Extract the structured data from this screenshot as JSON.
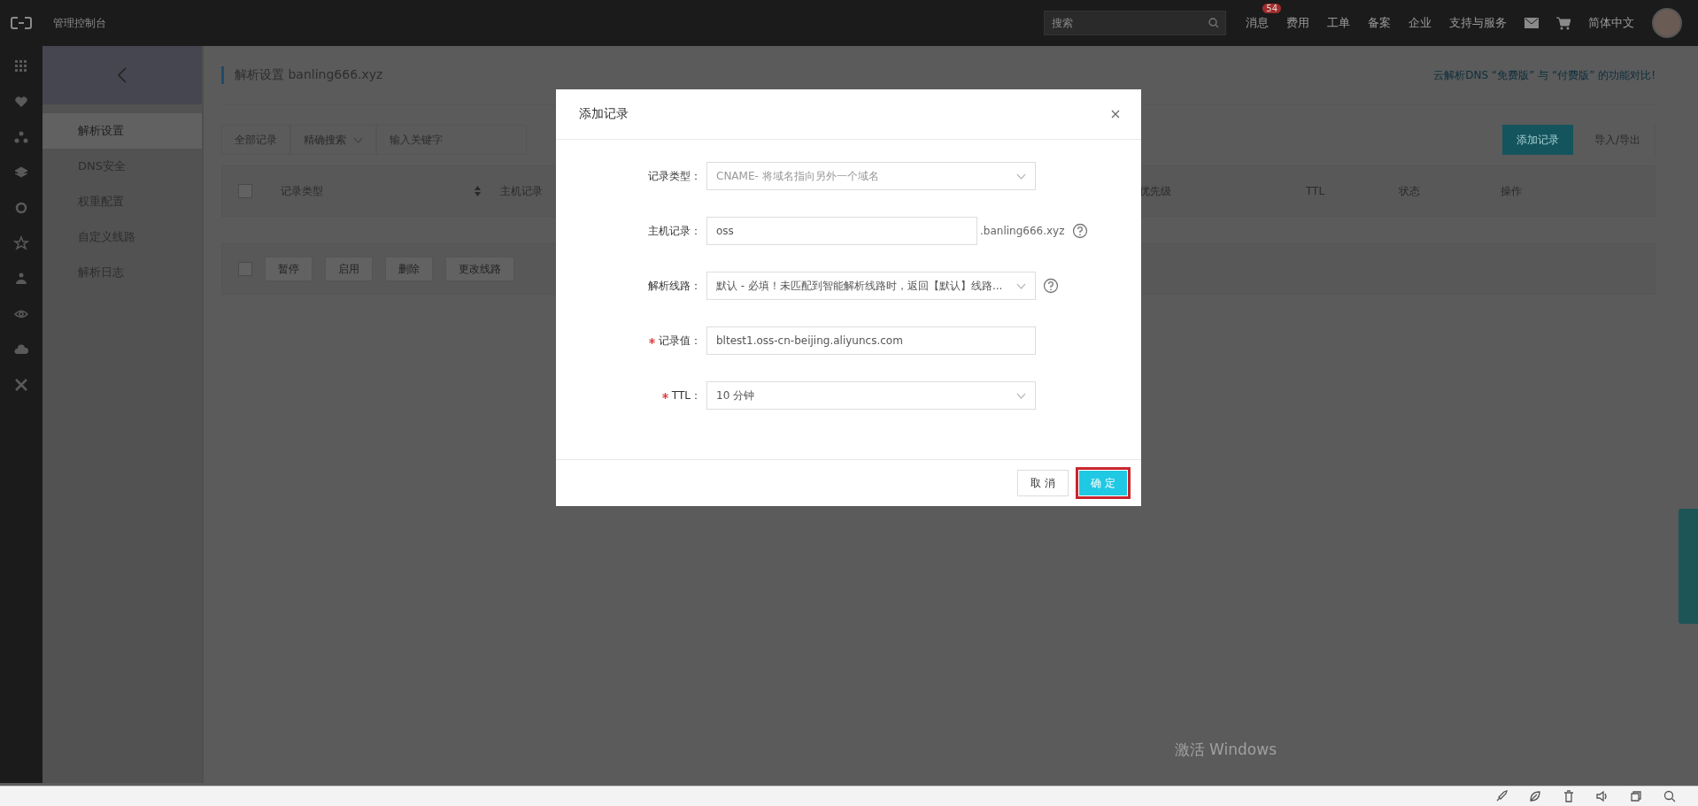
{
  "topbar": {
    "title": "管理控制台",
    "search": {
      "placeholder": "搜索"
    },
    "nav": [
      {
        "label": "消息",
        "badge": "54"
      },
      {
        "label": "费用"
      },
      {
        "label": "工单"
      },
      {
        "label": "备案"
      },
      {
        "label": "企业"
      },
      {
        "label": "支持与服务"
      }
    ],
    "language": "简体中文"
  },
  "table_select_all": {
    "checked": false
  },
  "batch_select": {
    "checked": false
  },
  "sidebar": {
    "items": [
      {
        "label": "解析设置",
        "selected": true
      },
      {
        "label": "DNS安全",
        "selected": false
      },
      {
        "label": "权重配置",
        "selected": false
      },
      {
        "label": "自定义线路",
        "selected": false
      },
      {
        "label": "解析日志",
        "selected": false
      }
    ]
  },
  "page": {
    "title": "解析设置 banling666.xyz",
    "compare_link": "云解析DNS “免费版” 与 “付费版” 的功能对比!",
    "filter": "全部记录",
    "search_mode": "精确搜索",
    "search": {
      "placeholder": "输入关键字"
    },
    "buttons": [
      {
        "label": "添加记录",
        "kind": "primary"
      },
      {
        "label": "导入/导出",
        "kind": "plain"
      }
    ],
    "table": {
      "columns": [
        "记录类型",
        "主机记录",
        "优先级",
        "TTL",
        "状态",
        "操作"
      ]
    },
    "batch_buttons": [
      "暂停",
      "启用",
      "删除",
      "更改线路"
    ]
  },
  "dialog": {
    "title": "添加记录",
    "fields": [
      {
        "label": "记录类型：",
        "required": false,
        "kind": "select",
        "value": "CNAME- 将域名指向另外一个域名",
        "disabled": true
      },
      {
        "label": "主机记录：",
        "required": false,
        "kind": "input",
        "value": "oss",
        "suffix": ".banling666.xyz",
        "help": true
      },
      {
        "label": "解析线路：",
        "required": false,
        "kind": "select",
        "value": "默认 - 必填！未匹配到智能解析线路时，返回【默认】线路...",
        "help": true
      },
      {
        "label": "记录值：",
        "required": true,
        "kind": "input",
        "value": "bltest1.oss-cn-beijing.aliyuncs.com"
      },
      {
        "label": "TTL：",
        "required": true,
        "kind": "select",
        "value": "10 分钟"
      }
    ],
    "buttons": [
      {
        "label": "取 消",
        "kind": "secondary",
        "highlighted": false
      },
      {
        "label": "确 定",
        "kind": "primary",
        "highlighted": true
      }
    ]
  },
  "system": {
    "watermark": "激活 Windows"
  }
}
